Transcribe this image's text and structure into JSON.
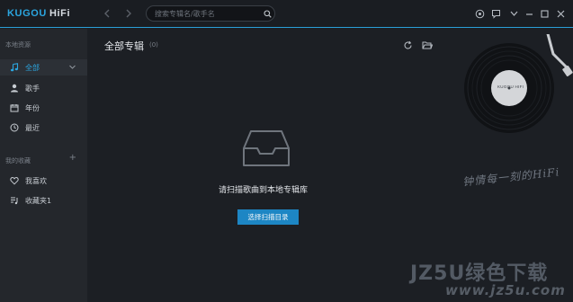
{
  "app": {
    "logo_main": "KUGOU",
    "logo_sub": "HiFi"
  },
  "search": {
    "placeholder": "搜索专辑名/歌手名"
  },
  "sidebar": {
    "local_title": "本地资源",
    "local_items": [
      {
        "label": "全部",
        "icon": "music-note-icon",
        "active": true
      },
      {
        "label": "歌手",
        "icon": "person-icon",
        "active": false
      },
      {
        "label": "年份",
        "icon": "calendar-icon",
        "active": false
      },
      {
        "label": "最近",
        "icon": "clock-icon",
        "active": false
      }
    ],
    "collection_title": "我的收藏",
    "collection_items": [
      {
        "label": "我喜欢",
        "icon": "heart-icon"
      },
      {
        "label": "收藏夹1",
        "icon": "playlist-icon"
      }
    ]
  },
  "main": {
    "title": "全部专辑",
    "count": "(0)",
    "empty_message": "请扫描歌曲到本地专辑库",
    "scan_button": "选择扫描目录"
  },
  "turntable": {
    "label": "KUGOU HIFI",
    "signature": "钟情每一刻的HiFi"
  },
  "watermark": {
    "brand": "JZ5U绿色下载",
    "url": "www.jz5u.com"
  },
  "colors": {
    "accent": "#2ba6e0",
    "button": "#1d86c4",
    "sidebar_bg": "#24272c",
    "main_bg": "#1c1f24"
  }
}
